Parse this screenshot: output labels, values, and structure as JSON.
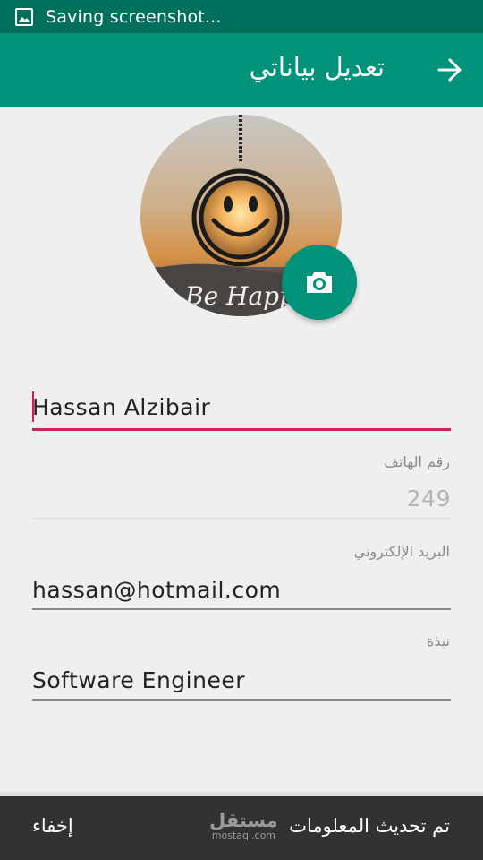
{
  "status_bar": {
    "text": "Saving screenshot...",
    "icon": "image-icon"
  },
  "app_bar": {
    "title": "تعديل بياناتي",
    "back_icon": "arrow-forward-icon",
    "color": "#00937a",
    "status_color": "#00705c"
  },
  "profile": {
    "avatar_text": "Be Happ",
    "camera_icon": "camera-icon"
  },
  "form": {
    "name": {
      "value": "Hassan Alzibair"
    },
    "phone": {
      "label": "رقم الهاتف",
      "value": "249"
    },
    "email": {
      "label": "البريد الإلكتروني",
      "value": "hassan@hotmail.com"
    },
    "bio": {
      "label": "نبذة",
      "value": "Software Engineer"
    },
    "accent_color": "#d81b60"
  },
  "snackbar": {
    "message": "تم تحديث المعلومات",
    "action": "إخفاء",
    "watermark_main": "مستقل",
    "watermark_sub": "mostaql.com"
  }
}
